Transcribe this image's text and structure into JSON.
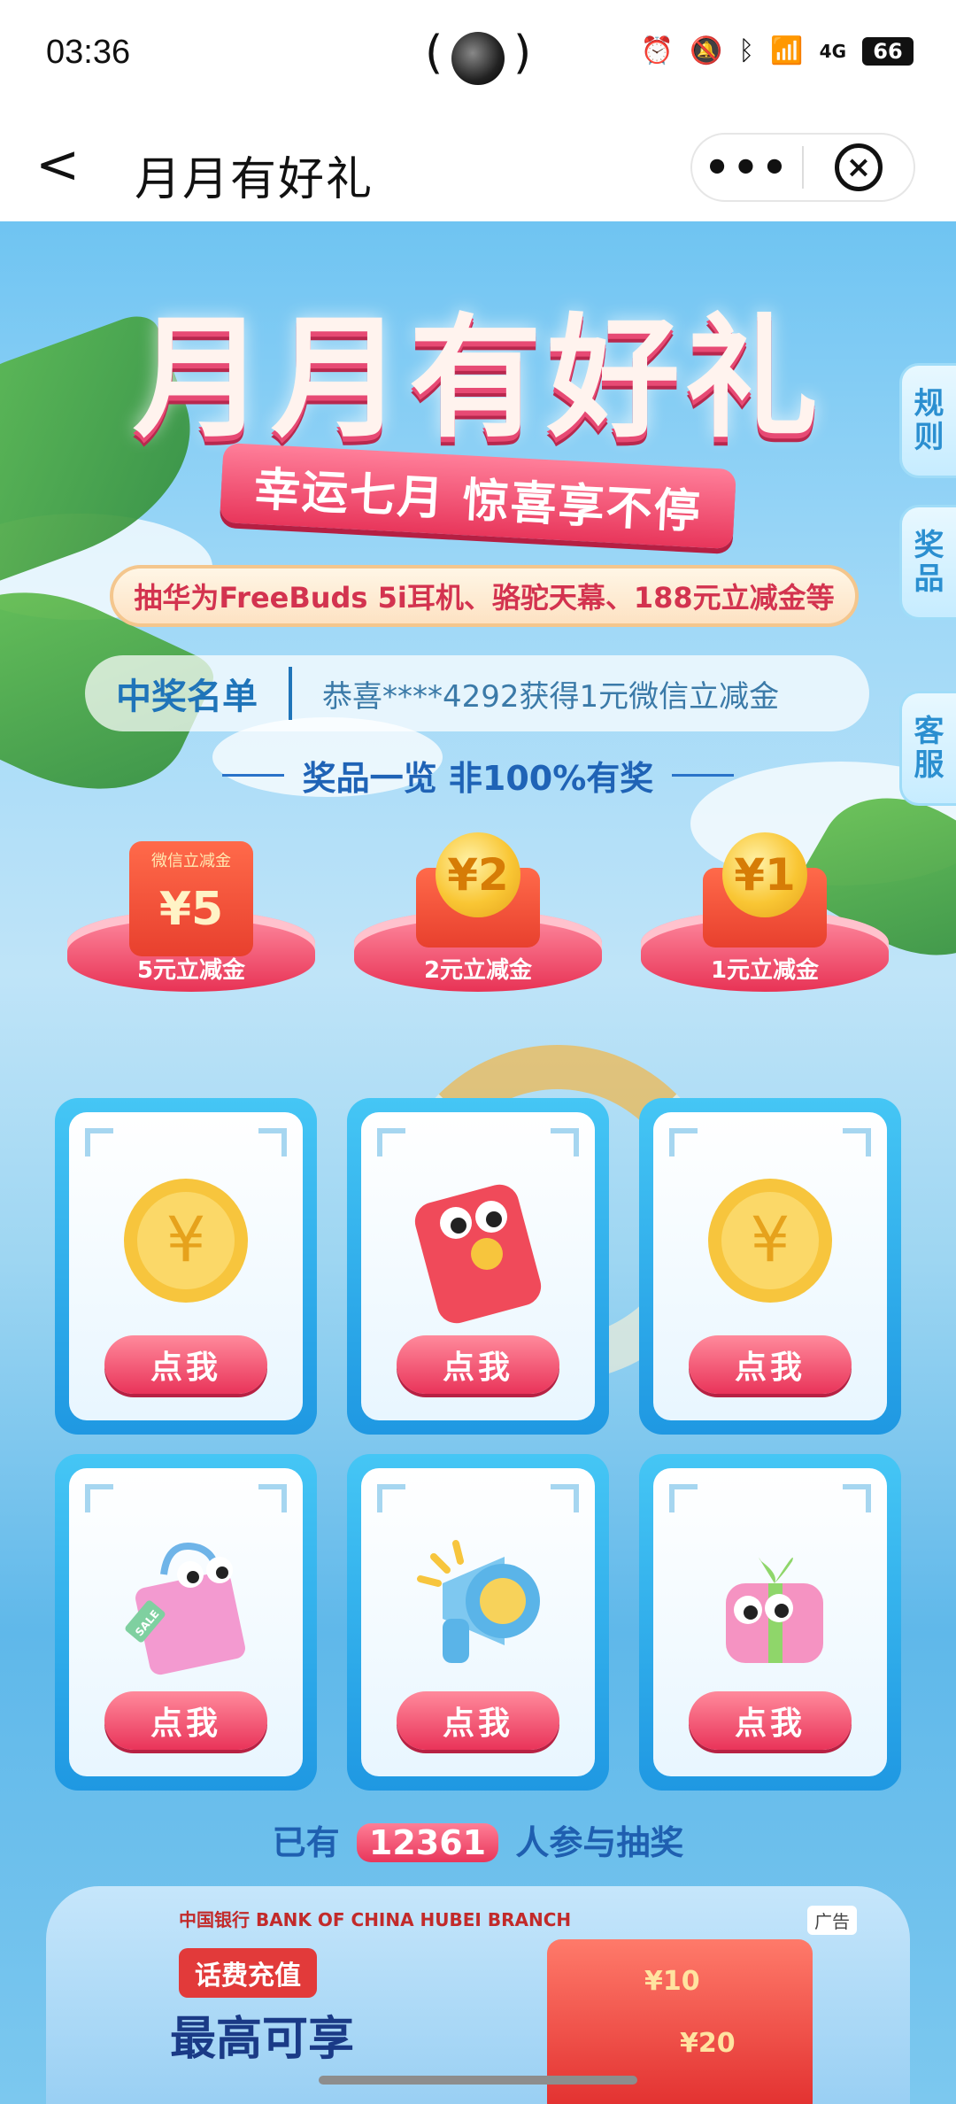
{
  "status_bar": {
    "time": "03:36",
    "icons": [
      "alarm-icon",
      "mute-icon",
      "bluetooth-icon",
      "wifi-icon",
      "signal-4g-icon"
    ],
    "network": "4G",
    "battery": "66"
  },
  "titlebar": {
    "back_glyph": "<",
    "title": "月月有好礼",
    "more_glyph": "•••",
    "close_glyph": "×"
  },
  "hero": {
    "title": "月月有好礼",
    "ribbon": "幸运七月 惊喜享不停",
    "subtitle": "抽华为FreeBuds 5i耳机、骆驼天幕、188元立减金等"
  },
  "side_tabs": [
    {
      "label": "规则"
    },
    {
      "label": "奖品"
    },
    {
      "label": "客服"
    }
  ],
  "winners": {
    "label": "中奖名单",
    "message": "恭喜****4292获得1元微信立减金"
  },
  "prizes_section": {
    "heading": "奖品一览  非100%有奖"
  },
  "prizes": [
    {
      "label": "5元立减金",
      "envelope_top": "微信立减金",
      "envelope_value": "¥5"
    },
    {
      "label": "2元立减金",
      "coin_value": "¥2"
    },
    {
      "label": "1元立减金",
      "coin_value": "¥1"
    }
  ],
  "draw_cards": [
    {
      "button": "点我",
      "icon": "gold-coin-icon"
    },
    {
      "button": "点我",
      "icon": "red-envelope-mascot-icon"
    },
    {
      "button": "点我",
      "icon": "gold-coin-icon"
    },
    {
      "button": "点我",
      "icon": "shopping-bag-icon",
      "tag": "SALE"
    },
    {
      "button": "点我",
      "icon": "megaphone-icon"
    },
    {
      "button": "点我",
      "icon": "gift-box-icon"
    }
  ],
  "participants": {
    "prefix": "已有",
    "count": "12361",
    "suffix": "人参与抽奖"
  },
  "ad": {
    "bank": "中国银行 BANK OF CHINA HUBEI BRANCH",
    "tag": "广告",
    "badge": "话费充值",
    "headline": "最高可享",
    "envelope_values": [
      "¥10",
      "¥20"
    ]
  }
}
